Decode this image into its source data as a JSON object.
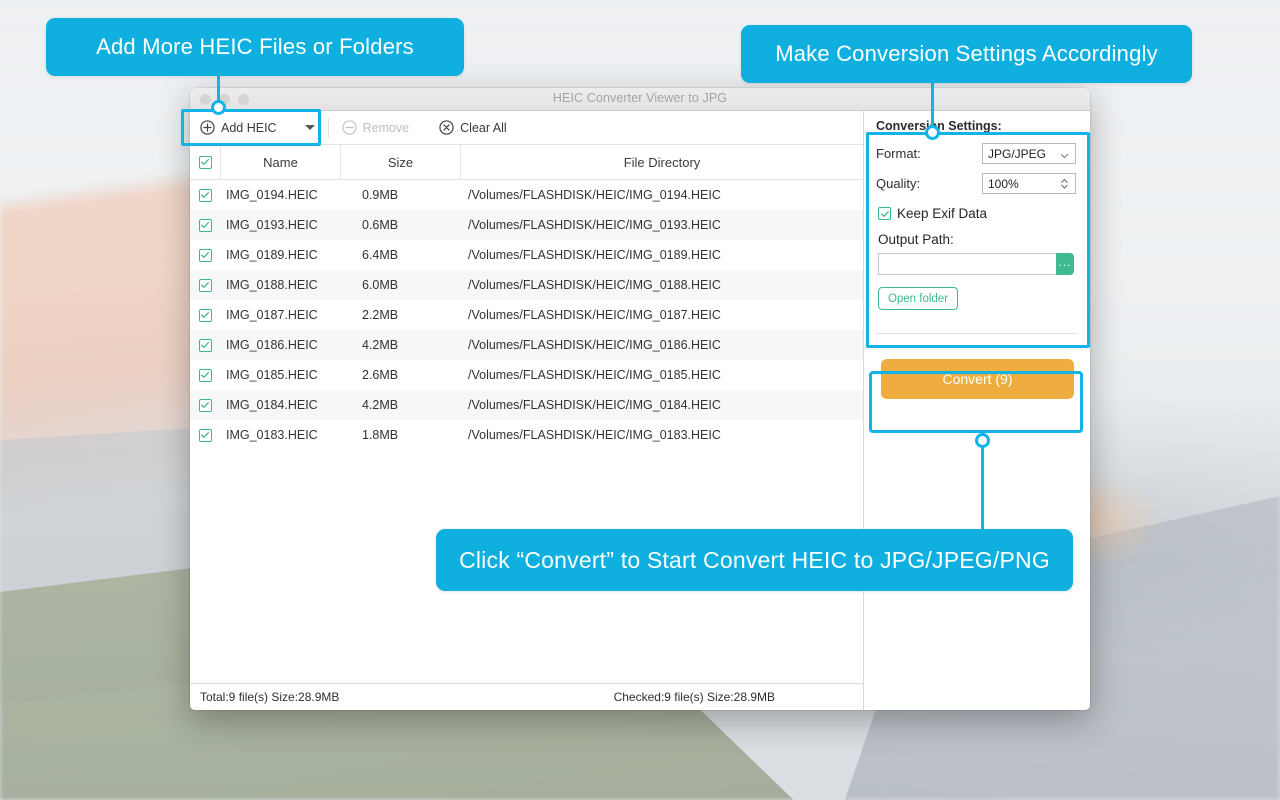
{
  "window": {
    "title": "HEIC Converter Viewer to JPG"
  },
  "toolbar": {
    "add_label": "Add HEIC",
    "remove_label": "Remove",
    "clear_label": "Clear All",
    "add_icon": "plus-circle-icon",
    "remove_icon": "minus-circle-icon",
    "clear_icon": "x-circle-icon",
    "dropdown_icon": "caret-down-icon"
  },
  "table": {
    "headers": {
      "select_all": "select-all-checkbox",
      "name": "Name",
      "size": "Size",
      "directory": "File Directory"
    },
    "rows": [
      {
        "checked": true,
        "name": "IMG_0194.HEIC",
        "size": "0.9MB",
        "directory": "/Volumes/FLASHDISK/HEIC/IMG_0194.HEIC"
      },
      {
        "checked": true,
        "name": "IMG_0193.HEIC",
        "size": "0.6MB",
        "directory": "/Volumes/FLASHDISK/HEIC/IMG_0193.HEIC"
      },
      {
        "checked": true,
        "name": "IMG_0189.HEIC",
        "size": "6.4MB",
        "directory": "/Volumes/FLASHDISK/HEIC/IMG_0189.HEIC"
      },
      {
        "checked": true,
        "name": "IMG_0188.HEIC",
        "size": "6.0MB",
        "directory": "/Volumes/FLASHDISK/HEIC/IMG_0188.HEIC"
      },
      {
        "checked": true,
        "name": "IMG_0187.HEIC",
        "size": "2.2MB",
        "directory": "/Volumes/FLASHDISK/HEIC/IMG_0187.HEIC"
      },
      {
        "checked": true,
        "name": "IMG_0186.HEIC",
        "size": "4.2MB",
        "directory": "/Volumes/FLASHDISK/HEIC/IMG_0186.HEIC"
      },
      {
        "checked": true,
        "name": "IMG_0185.HEIC",
        "size": "2.6MB",
        "directory": "/Volumes/FLASHDISK/HEIC/IMG_0185.HEIC"
      },
      {
        "checked": true,
        "name": "IMG_0184.HEIC",
        "size": "4.2MB",
        "directory": "/Volumes/FLASHDISK/HEIC/IMG_0184.HEIC"
      },
      {
        "checked": true,
        "name": "IMG_0183.HEIC",
        "size": "1.8MB",
        "directory": "/Volumes/FLASHDISK/HEIC/IMG_0183.HEIC"
      }
    ]
  },
  "statusbar": {
    "total": "Total:9 file(s) Size:28.9MB",
    "checked": "Checked:9 file(s) Size:28.9MB"
  },
  "settings": {
    "title": "Conversion Settings:",
    "format_label": "Format:",
    "format_value": "JPG/JPEG",
    "quality_label": "Quality:",
    "quality_value": "100%",
    "keep_exif_label": "Keep Exif Data",
    "keep_exif_checked": true,
    "output_path_label": "Output Path:",
    "output_path_value": "",
    "browse_label": "...",
    "open_folder_label": "Open folder"
  },
  "convert": {
    "label": "Convert (9)"
  },
  "callouts": {
    "add": "Add More HEIC Files or Folders",
    "settings": "Make Conversion Settings Accordingly",
    "convert": "Click  “Convert” to Start Convert HEIC to JPG/JPEG/PNG"
  },
  "colors": {
    "callout_blue": "#0fb0e0",
    "highlight_blue": "#12b4e8",
    "convert_orange": "#f0ad3f",
    "accent_green": "#3fba90"
  }
}
